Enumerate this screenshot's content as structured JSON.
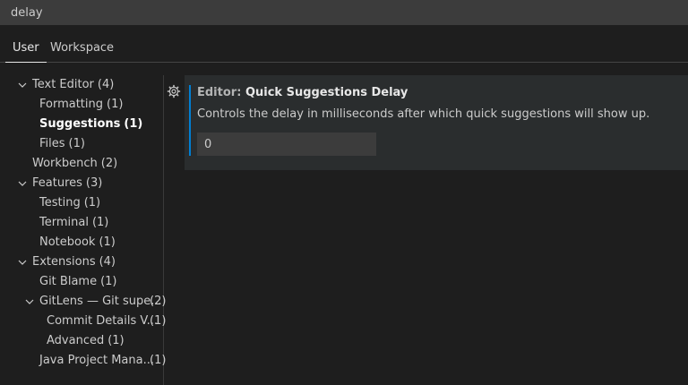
{
  "search": {
    "value": "delay"
  },
  "tabs": [
    {
      "label": "User"
    },
    {
      "label": "Workspace"
    }
  ],
  "toc": [
    {
      "name": "Text Editor",
      "count": "(4)"
    },
    {
      "name": "Formatting",
      "count": "(1)"
    },
    {
      "name": "Suggestions",
      "count": "(1)"
    },
    {
      "name": "Files",
      "count": "(1)"
    },
    {
      "name": "Workbench",
      "count": "(2)"
    },
    {
      "name": "Features",
      "count": "(3)"
    },
    {
      "name": "Testing",
      "count": "(1)"
    },
    {
      "name": "Terminal",
      "count": "(1)"
    },
    {
      "name": "Notebook",
      "count": "(1)"
    },
    {
      "name": "Extensions",
      "count": "(4)"
    },
    {
      "name": "Git Blame",
      "count": "(1)"
    },
    {
      "name": "GitLens — Git supe...",
      "count": "(2)"
    },
    {
      "name": "Commit Details V...",
      "count": "(1)"
    },
    {
      "name": "Advanced",
      "count": "(1)"
    },
    {
      "name": "Java Project Mana...",
      "count": "(1)"
    }
  ],
  "setting": {
    "category": "Editor: ",
    "label": "Quick Suggestions Delay",
    "description": "Controls the delay in milliseconds after which quick suggestions will show up.",
    "value": "0"
  },
  "icons": {
    "chevron": "chevron-down-icon",
    "gear": "gear-icon"
  },
  "colors": {
    "accent": "#007fd4",
    "background": "#1e1e1e",
    "input_background": "#3c3c3c"
  }
}
